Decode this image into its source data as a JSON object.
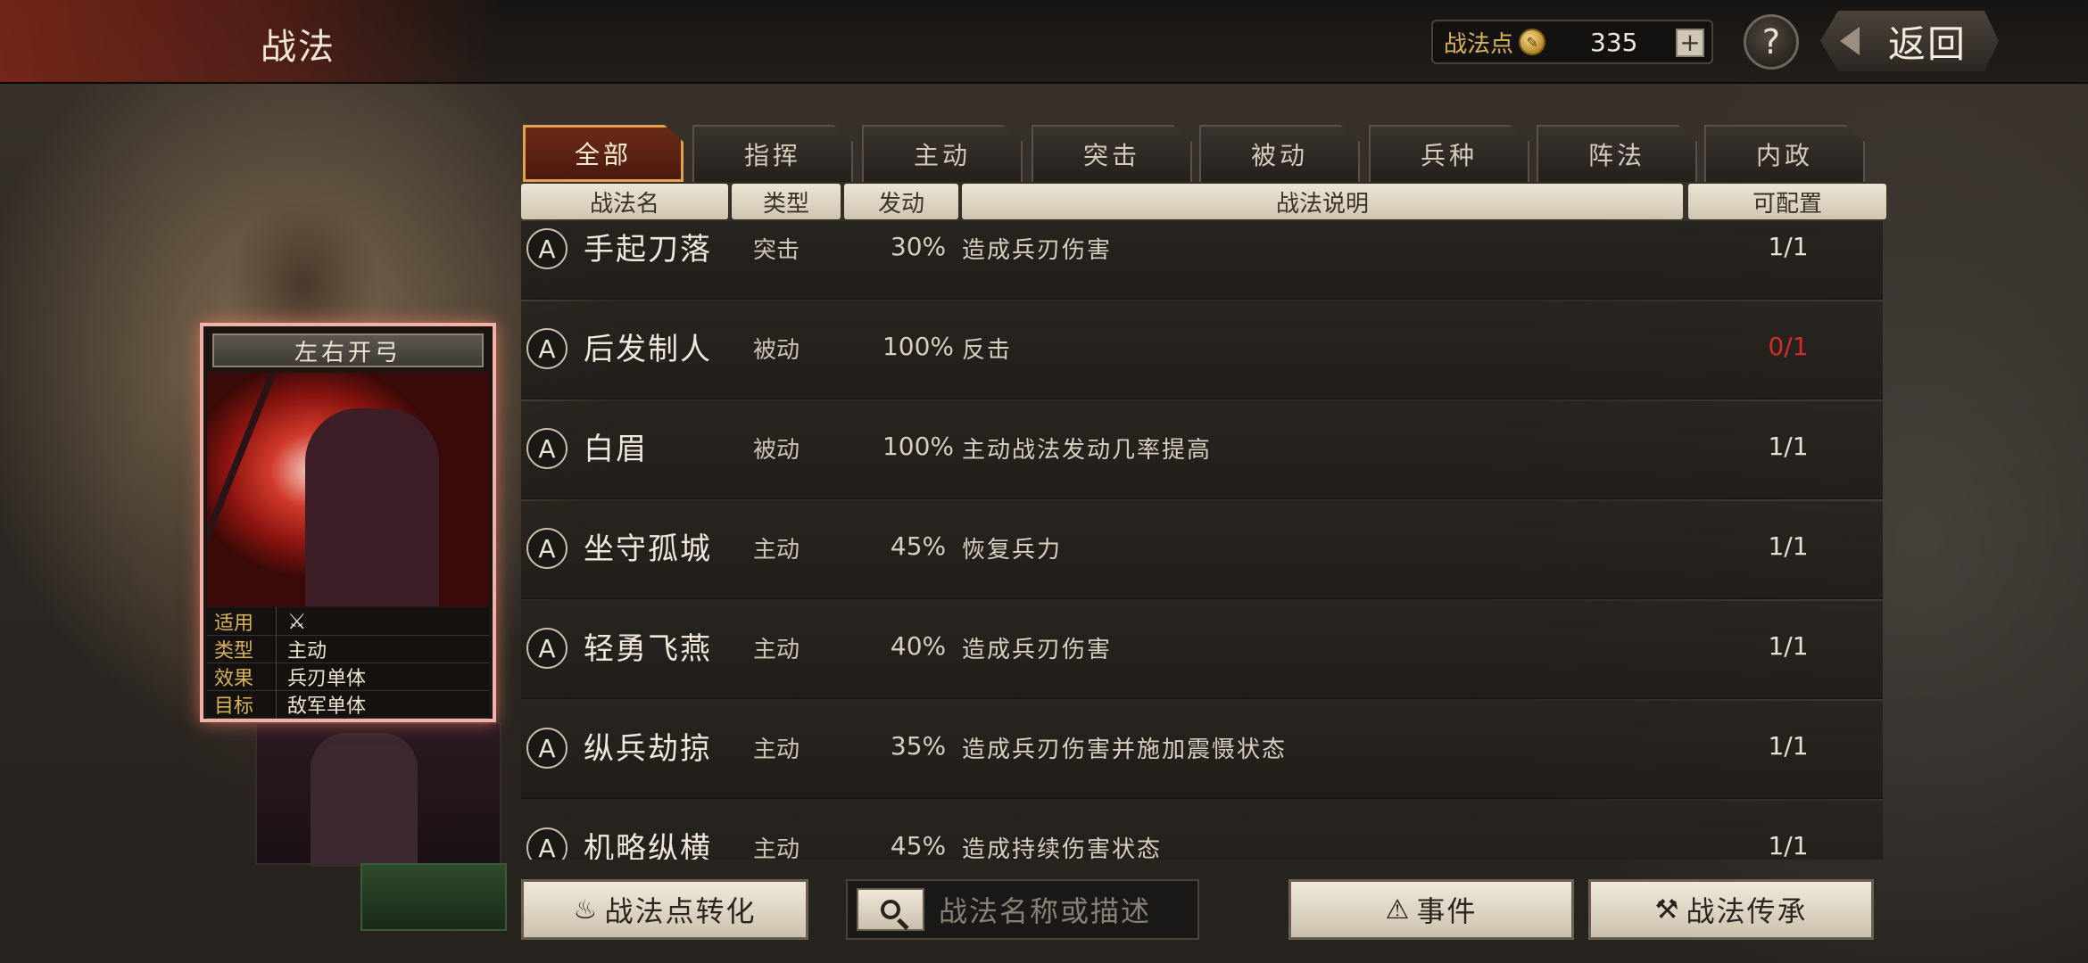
{
  "header": {
    "title": "战法",
    "points_label": "战法点",
    "points_value": "335",
    "plus_label": "+",
    "help_label": "?",
    "back_label": "返回"
  },
  "tabs": [
    {
      "label": "全部",
      "active": true
    },
    {
      "label": "指挥"
    },
    {
      "label": "主动"
    },
    {
      "label": "突击"
    },
    {
      "label": "被动"
    },
    {
      "label": "兵种"
    },
    {
      "label": "阵法"
    },
    {
      "label": "内政"
    }
  ],
  "columns": {
    "name": "战法名",
    "type": "类型",
    "rate": "发动",
    "desc": "战法说明",
    "count": "可配置"
  },
  "rows": [
    {
      "grade": "A",
      "name": "手起刀落",
      "type": "突击",
      "rate": "30%",
      "desc": "造成兵刃伤害",
      "count": "1/1"
    },
    {
      "grade": "A",
      "name": "后发制人",
      "type": "被动",
      "rate": "100%",
      "desc": "反击",
      "count": "0/1",
      "count_color": "#d62b2b"
    },
    {
      "grade": "A",
      "name": "白眉",
      "type": "被动",
      "rate": "100%",
      "desc": "主动战法发动几率提高",
      "count": "1/1"
    },
    {
      "grade": "A",
      "name": "坐守孤城",
      "type": "主动",
      "rate": "45%",
      "desc": "恢复兵力",
      "count": "1/1"
    },
    {
      "grade": "A",
      "name": "轻勇飞燕",
      "type": "主动",
      "rate": "40%",
      "desc": "造成兵刃伤害",
      "count": "1/1"
    },
    {
      "grade": "A",
      "name": "纵兵劫掠",
      "type": "主动",
      "rate": "35%",
      "desc": "造成兵刃伤害并施加震慑状态",
      "count": "1/1"
    },
    {
      "grade": "A",
      "name": "机略纵横",
      "type": "主动",
      "rate": "45%",
      "desc": "造成持续伤害状态",
      "count": "1/1"
    }
  ],
  "card": {
    "title": "左右开弓",
    "info": [
      {
        "key": "适用",
        "icon": "bow-icon",
        "value": "⚔"
      },
      {
        "key": "类型",
        "value": "主动"
      },
      {
        "key": "效果",
        "value": "兵刃单体"
      },
      {
        "key": "目标",
        "value": "敌军单体"
      }
    ]
  },
  "bottom": {
    "convert_label": "战法点转化",
    "search_placeholder": "战法名称或描述",
    "event_label": "事件",
    "inherit_label": "战法传承"
  },
  "colors": {
    "accent": "#e3a24a",
    "red_count": "#d62b2b",
    "gold_label": "#d9b35c"
  }
}
